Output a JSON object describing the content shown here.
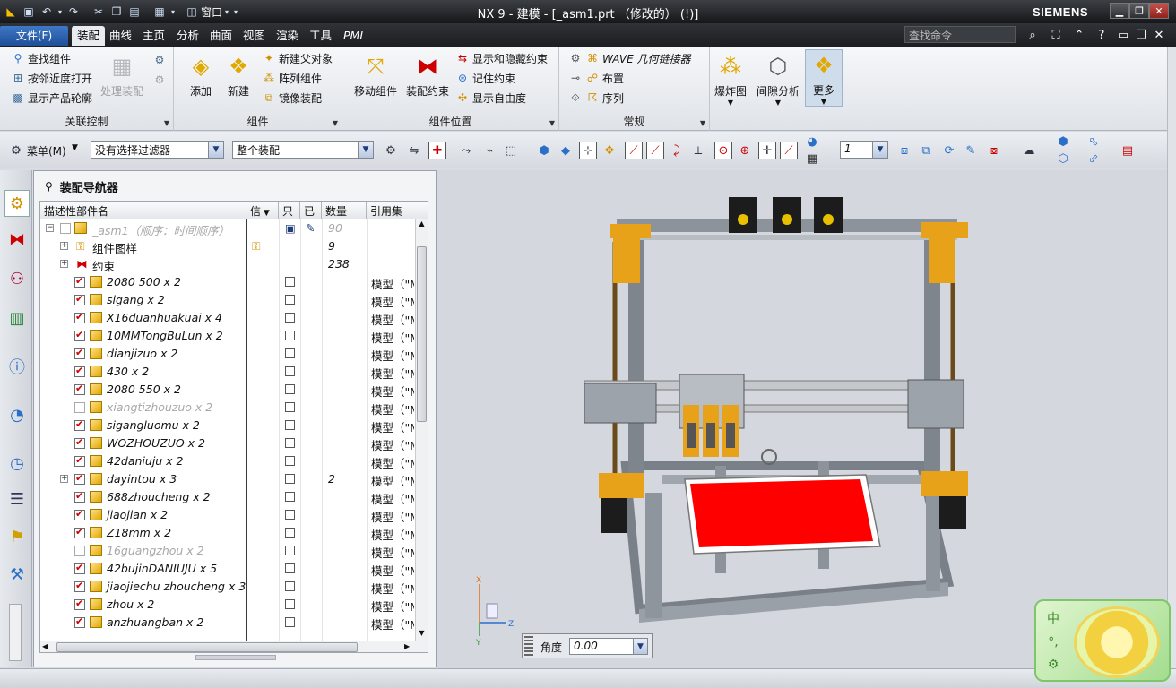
{
  "window": {
    "title": "NX 9 - 建模 - [_asm1.prt （修改的）    (!)]",
    "brand": "SIEMENS",
    "quick_access_window_label": "窗口"
  },
  "menu_tabs": {
    "file": "文件(F)",
    "items": [
      "装配",
      "曲线",
      "主页",
      "分析",
      "曲面",
      "视图",
      "渲染",
      "工具",
      "PMI"
    ],
    "active": "装配"
  },
  "search": {
    "placeholder": "查找命令"
  },
  "ribbon": {
    "group_relation": {
      "label": "关联控制",
      "items": [
        "查找组件",
        "按邻近度打开",
        "显示产品轮廓"
      ],
      "disabled_button": "处理装配"
    },
    "group_component": {
      "label": "组件",
      "big_buttons": [
        "添加",
        "新建"
      ],
      "items": [
        "新建父对象",
        "阵列组件",
        "镜像装配"
      ]
    },
    "group_position": {
      "label": "组件位置",
      "big_buttons": [
        "移动组件",
        "装配约束"
      ],
      "items": [
        "显示和隐藏约束",
        "记住约束",
        "显示自由度"
      ]
    },
    "group_general": {
      "label": "常规",
      "items": [
        "WAVE 几何链接器",
        "布置",
        "序列"
      ]
    },
    "extra_buttons": [
      "爆炸图",
      "间隙分析",
      "更多"
    ]
  },
  "toolbar": {
    "menu_label": "菜单(M)",
    "filter_value": "没有选择过滤器",
    "scope_value": "整个装配",
    "layer_value": "1"
  },
  "navigator": {
    "title": "装配导航器",
    "columns": [
      "描述性部件名",
      "信",
      "只",
      "已",
      "数量",
      "引用集"
    ],
    "root": {
      "name": "_asm1（顺序：时间顺序）",
      "qty": "90"
    },
    "folders": [
      {
        "name": "组件图样",
        "qty": "9"
      },
      {
        "name": "约束",
        "qty": "238"
      }
    ],
    "rows": [
      {
        "name": "2080   500 x 2",
        "ref": "模型（\"MODEL\"）",
        "grey": false,
        "qty": ""
      },
      {
        "name": "sigang x 2",
        "ref": "模型（\"MODEL\"）",
        "grey": false,
        "qty": ""
      },
      {
        "name": "X16duanhuakuai x 4",
        "ref": "模型（\"MODEL\"）",
        "grey": false,
        "qty": ""
      },
      {
        "name": "10MMTongBuLun x 2",
        "ref": "模型（\"MODEL\"）",
        "grey": false,
        "qty": ""
      },
      {
        "name": "dianjizuo x 2",
        "ref": "模型（\"MODEL\"）",
        "grey": false,
        "qty": ""
      },
      {
        "name": "430 x 2",
        "ref": "模型（\"MODEL\"）",
        "grey": false,
        "qty": ""
      },
      {
        "name": "2080 550 x 2",
        "ref": "模型（\"MODEL\"）",
        "grey": false,
        "qty": ""
      },
      {
        "name": "xiangtizhouzuo x 2",
        "ref": "模型（\"MODEL\"）",
        "grey": true,
        "qty": ""
      },
      {
        "name": "sigangluomu x 2",
        "ref": "模型（\"MODEL\"）",
        "grey": false,
        "qty": ""
      },
      {
        "name": "WOZHOUZUO x 2",
        "ref": "模型（\"MODEL\"）",
        "grey": false,
        "qty": ""
      },
      {
        "name": "42daniuju x 2",
        "ref": "模型（\"MODEL\"）",
        "grey": false,
        "qty": ""
      },
      {
        "name": "dayintou x 3",
        "ref": "模型（\"MODEL\"）",
        "grey": false,
        "qty": "2",
        "expand": true
      },
      {
        "name": "688zhoucheng x 2",
        "ref": "模型（\"MODEL\"）",
        "grey": false,
        "qty": ""
      },
      {
        "name": "jiaojian x 2",
        "ref": "模型（\"MODEL\"）",
        "grey": false,
        "qty": ""
      },
      {
        "name": "Z18mm x 2",
        "ref": "模型（\"MODEL\"）",
        "grey": false,
        "qty": ""
      },
      {
        "name": "16guangzhou x 2",
        "ref": "模型（\"MODEL\"）",
        "grey": true,
        "qty": ""
      },
      {
        "name": "42bujinDANIUJU x 5",
        "ref": "模型（\"MODEL\"）",
        "grey": false,
        "qty": ""
      },
      {
        "name": "jiaojiechu zhoucheng x 3",
        "ref": "模型（\"MODEL\"）",
        "grey": false,
        "qty": ""
      },
      {
        "name": "zhou x 2",
        "ref": "模型（\"MODEL\"）",
        "grey": false,
        "qty": ""
      },
      {
        "name": "anzhuangban x 2",
        "ref": "模型（\"MODEL\"）",
        "grey": false,
        "qty": ""
      }
    ]
  },
  "viewport": {
    "triad": {
      "x_label": "X",
      "y_label": "Y",
      "z_label": "Z"
    },
    "angle_label": "角度",
    "angle_value": "0.00",
    "bed_color": "#ff0000",
    "frame_color": "#7a8088",
    "accent_color": "#e8a21a"
  },
  "ime": {
    "chars": [
      "中",
      "°,",
      "⚙"
    ]
  }
}
